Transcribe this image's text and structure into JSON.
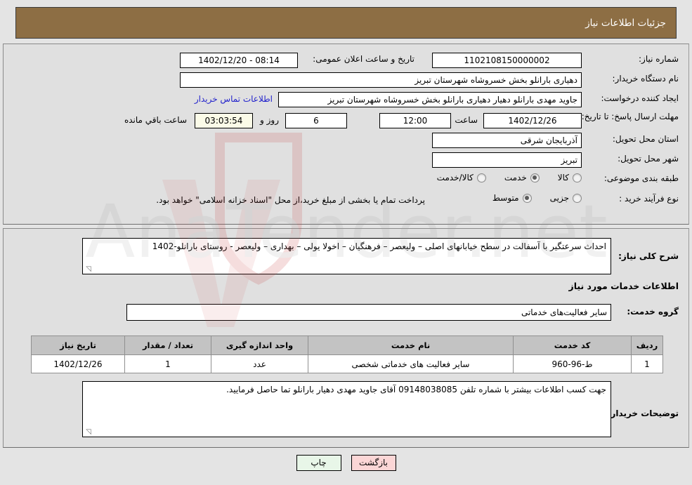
{
  "header": {
    "title": "جزئیات اطلاعات نیاز"
  },
  "form": {
    "need_number_label": "شماره نیاز:",
    "need_number_value": "1102108150000002",
    "announce_label": "تاریخ و ساعت اعلان عمومی:",
    "announce_value": "08:14 - 1402/12/20",
    "buyer_org_label": "نام دستگاه خریدار:",
    "buyer_org_value": "دهیاری بارانلو بخش خسروشاه شهرستان تبریز",
    "requester_label": "ایجاد کننده درخواست:",
    "requester_value": "جاوید مهدی بارانلو دهیار دهیاری بارانلو بخش خسروشاه شهرستان تبریز",
    "contact_link": "اطلاعات تماس خریدار",
    "deadline_label": "مهلت ارسال پاسخ: تا تاریخ:",
    "deadline_date": "1402/12/26",
    "hour_label": "ساعت",
    "hour_value": "12:00",
    "days_value": "6",
    "days_label": "روز و",
    "countdown_value": "03:03:54",
    "remaining_label": "ساعت باقي مانده",
    "province_label": "استان محل تحویل:",
    "province_value": "آذربایجان شرقی",
    "city_label": "شهر محل تحویل:",
    "city_value": "تبریز",
    "category_label": "طبقه بندی موضوعی:",
    "category_options": [
      {
        "label": "کالا",
        "selected": false
      },
      {
        "label": "خدمت",
        "selected": true
      },
      {
        "label": "کالا/خدمت",
        "selected": false
      }
    ],
    "process_label": "نوع فرآیند خرید :",
    "process_options": [
      {
        "label": "جزیی",
        "selected": false
      },
      {
        "label": "متوسط",
        "selected": true
      }
    ],
    "treasury_note": "پرداخت تمام یا بخشی از مبلغ خرید،از محل \"اسناد خزانه اسلامی\" خواهد بود."
  },
  "details": {
    "summary_label": "شرح کلی نیاز:",
    "summary_value": "احداث سرعتگیر با آسفالت در سطح خیابانهای اصلی – ولیعصر – فرهنگیان – اخولا یولی – بهداری – ولیعصر - روستای بارانلو-1402",
    "services_section_title": "اطلاعات خدمات مورد نیاز",
    "service_group_label": "گروه خدمت:",
    "service_group_value": "سایر فعالیت‌های خدماتی",
    "buyer_notes_label": "توضیحات خریدار:",
    "buyer_notes_value": "جهت کسب اطلاعات بیشتر با شماره تلفن 09148038085 آقای جاوید مهدی دهیار بارانلو تما حاصل فرمایید."
  },
  "table": {
    "columns": [
      "ردیف",
      "کد خدمت",
      "نام خدمت",
      "واحد اندازه گیری",
      "تعداد / مقدار",
      "تاریخ نیاز"
    ],
    "rows": [
      {
        "index": "1",
        "code": "ط-96-960",
        "name": "سایر فعالیت های خدماتی شخصی",
        "unit": "عدد",
        "qty": "1",
        "date": "1402/12/26"
      }
    ]
  },
  "buttons": {
    "print": "چاپ",
    "back": "بازگشت"
  },
  "colors": {
    "header_brown": "#8d6e44",
    "page_bg": "#e4e4e4",
    "panel_bg": "#e0e0e0",
    "link_blue": "#2222cc",
    "table_header_gray": "#c3c3c3",
    "print_button_green": "#e8f6e8",
    "back_button_pink": "#fbd6d6",
    "countdown_cream": "#fbfbe8"
  },
  "watermark": {
    "text": "AnaTender.net"
  }
}
